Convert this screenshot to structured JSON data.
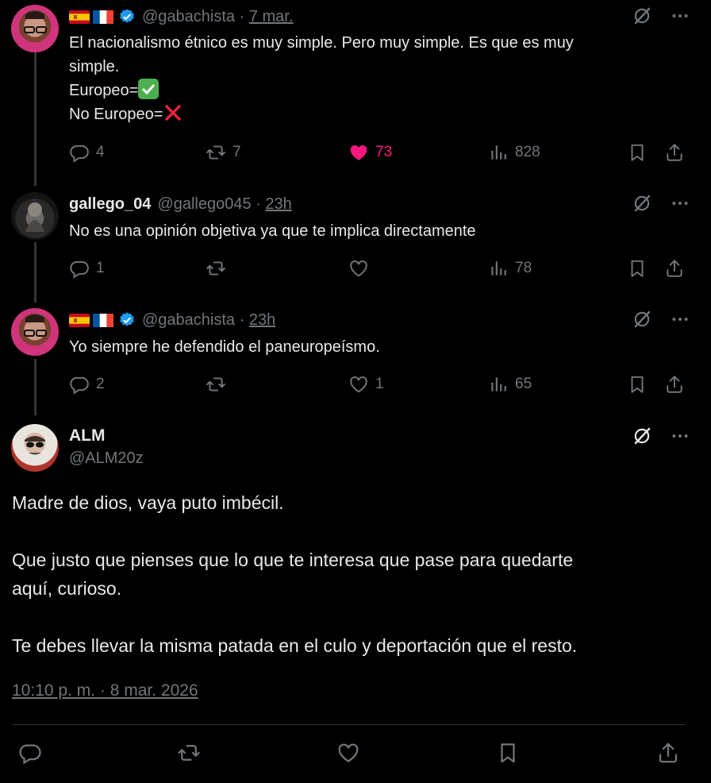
{
  "tweets": [
    {
      "handle": "@gabachista",
      "time": "7 mar.",
      "text_lines": [
        "El nacionalismo étnico es muy simple. Pero muy simple. Es que es muy",
        "simple.",
        "Europeo=",
        "No Europeo="
      ],
      "replies": "4",
      "retweets": "7",
      "likes": "73",
      "views": "828"
    },
    {
      "name": "gallego_04",
      "handle": "@gallego045",
      "time": "23h",
      "text": "No es una opinión objetiva ya que te implica directamente",
      "replies": "1",
      "retweets": "",
      "likes": "",
      "views": "78"
    },
    {
      "handle": "@gabachista",
      "time": "23h",
      "text": "Yo siempre he defendido el paneuropeísmo.",
      "replies": "2",
      "retweets": "",
      "likes": "1",
      "views": "65"
    }
  ],
  "main": {
    "name": "ALM",
    "handle": "@ALM20z",
    "paragraphs": [
      "Madre de dios, vaya puto imbécil.",
      "Que justo que pienses que lo que te interesa que pase para quedarte",
      "aquí, curioso.",
      "Te debes llevar la misma patada en el culo y deportación que el resto."
    ],
    "timestamp": "10:10 p. m. · 8 mar. 2026"
  },
  "colors": {
    "like_active": "#f91880",
    "muted": "#71767b",
    "verified": "#1d9bf0"
  },
  "icons": [
    "reply-icon",
    "retweet-icon",
    "like-icon",
    "views-icon",
    "bookmark-icon",
    "share-icon",
    "grok-icon",
    "more-icon",
    "verified-icon"
  ]
}
